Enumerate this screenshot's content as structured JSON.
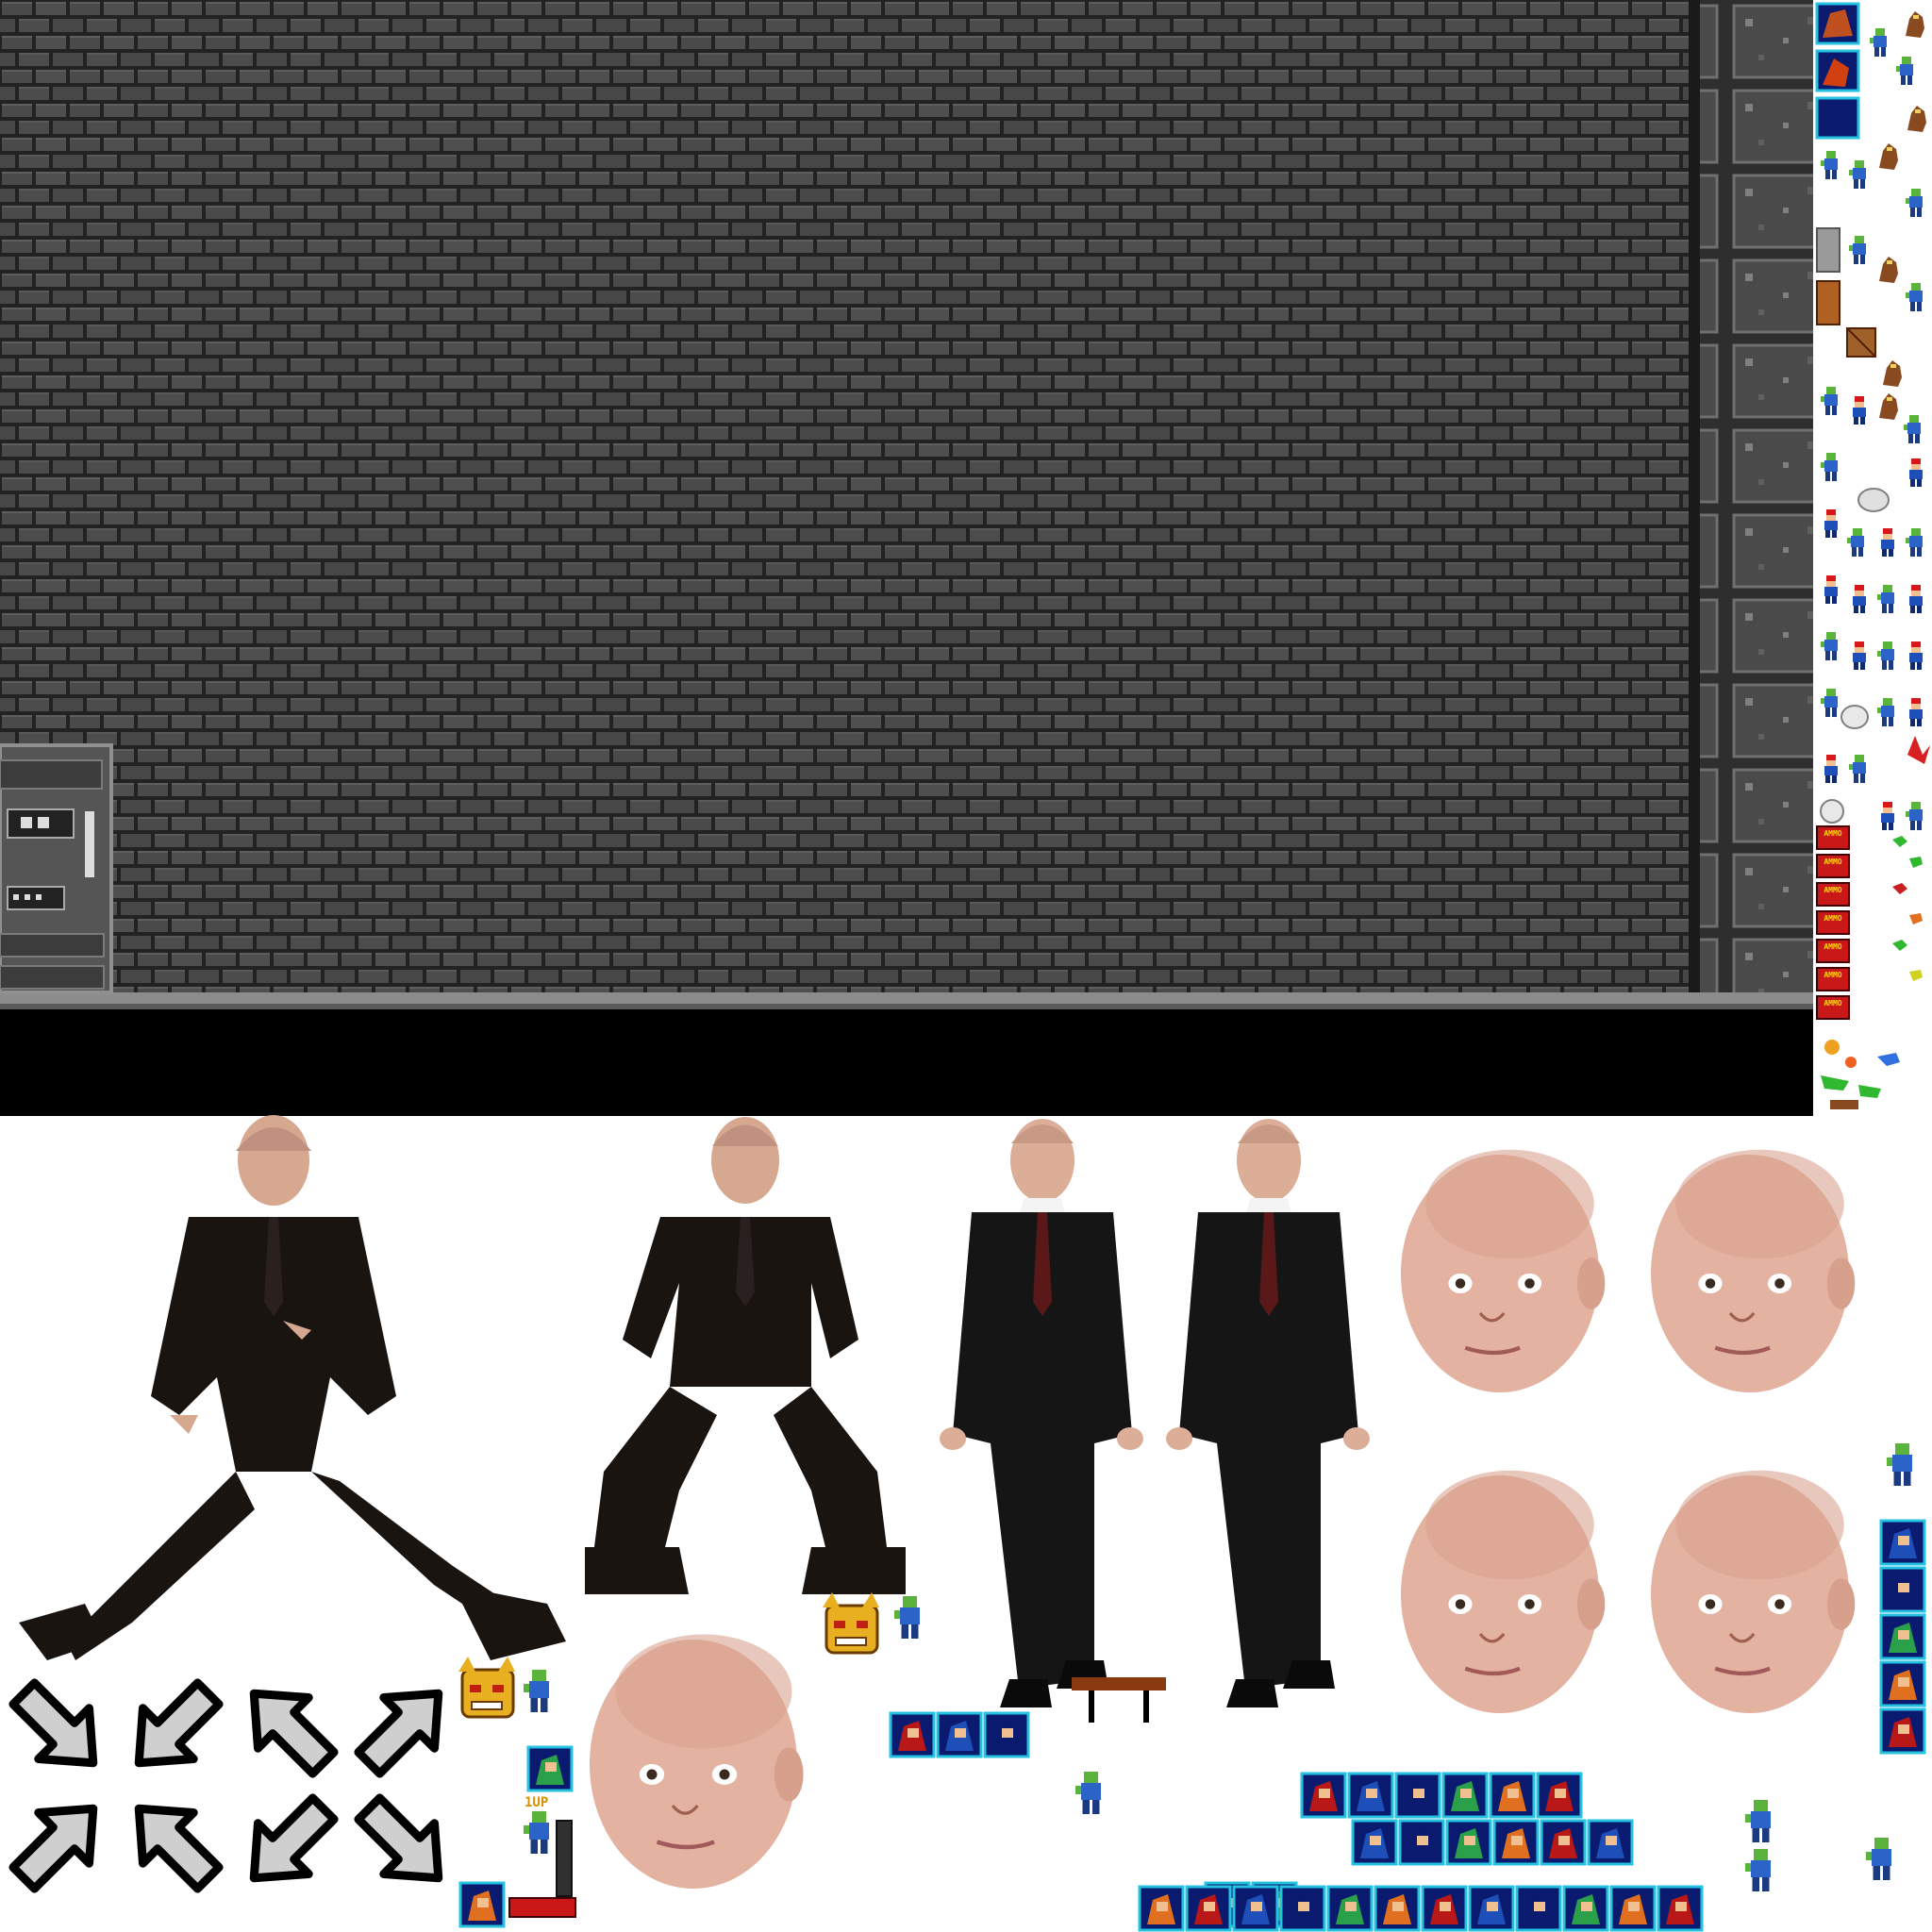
{
  "atlas": {
    "background_color": "#ffffff",
    "brick_color": "#4a4a4a",
    "mortar_color": "#222222",
    "accent_tile_border": "#24c1e0",
    "accent_tile_fill": "#0a1a6e"
  },
  "level": {
    "wall": "grey-brick-wall",
    "pillar": "stone-pillar",
    "floor": "black-floor",
    "panel": "control-panel"
  },
  "sprite_column": {
    "ammo_label": "AMMO",
    "ammo_count": 7
  },
  "characters": {
    "dancer_poses": [
      "dance-pose-split",
      "dance-pose-squat"
    ],
    "walker_poses": [
      "walk-pose-a",
      "walk-pose-b"
    ],
    "head_count": 5
  },
  "arrows": {
    "directions": [
      "in-down-right",
      "in-down-left",
      "out-up-left",
      "out-up-right",
      "in-up-right",
      "in-up-left",
      "out-down-left",
      "out-down-right"
    ]
  },
  "labels": {
    "oneup": "1UP"
  }
}
